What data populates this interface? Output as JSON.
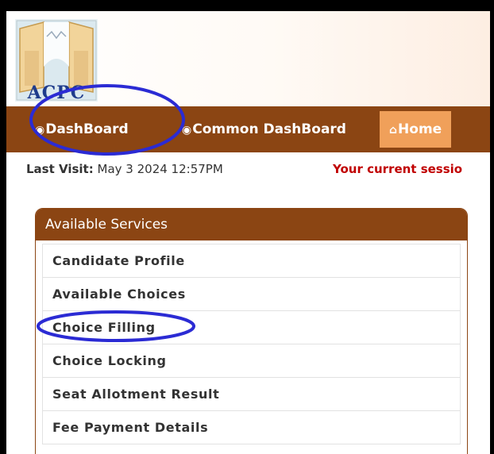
{
  "logo": {
    "text": "ACPC"
  },
  "nav": {
    "items": [
      {
        "label": "DashBoard",
        "icon": "dashboard-icon"
      },
      {
        "label": "Common DashBoard",
        "icon": "dashboard-icon"
      },
      {
        "label": "Home",
        "icon": "home-icon"
      }
    ]
  },
  "visit": {
    "label": "Last Visit:",
    "value": "May 3 2024 12:57PM",
    "session_message": "Your current sessio"
  },
  "services": {
    "title": "Available Services",
    "items": [
      "Candidate Profile",
      "Available Choices",
      "Choice Filling",
      "Choice Locking",
      "Seat Allotment Result",
      "Fee Payment Details"
    ]
  },
  "colors": {
    "brand": "#8b4513",
    "home_tab": "#f0a05a",
    "session_text": "#c00000",
    "annotation": "#2b2bd4"
  }
}
